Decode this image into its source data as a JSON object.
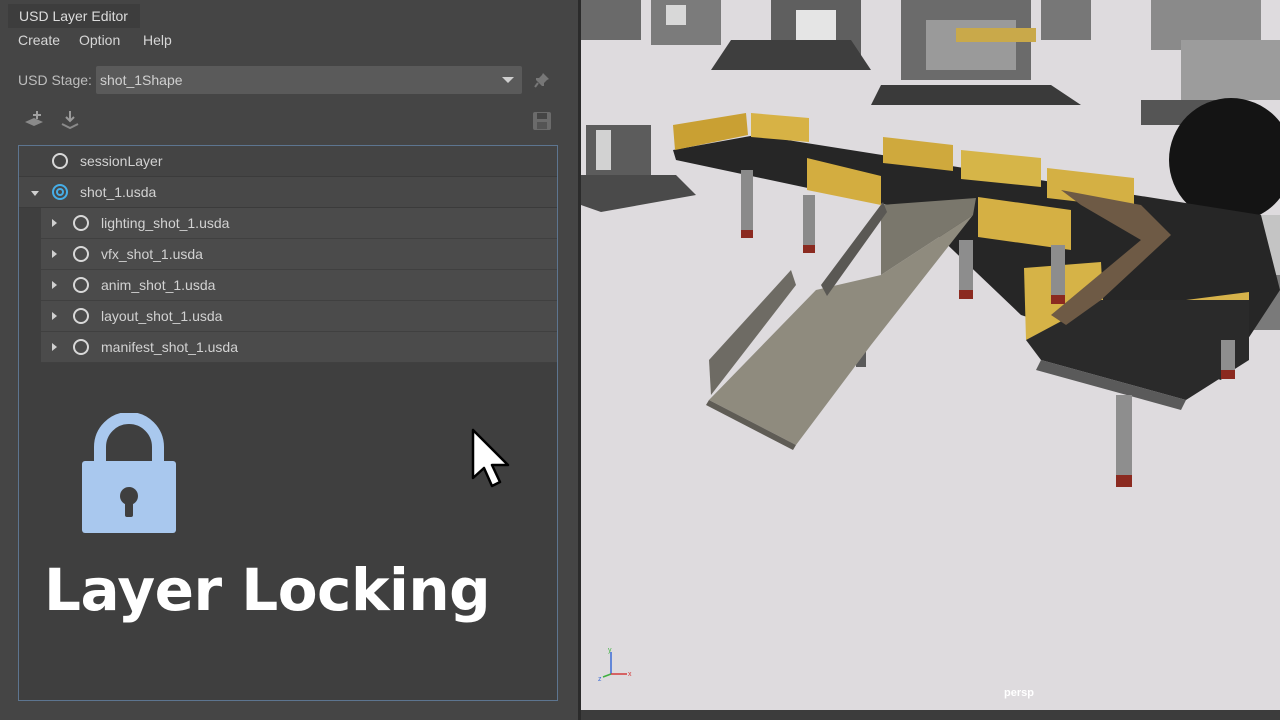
{
  "window": {
    "title": "USD Layer Editor"
  },
  "menu": {
    "items": [
      "Create",
      "Option",
      "Help"
    ]
  },
  "stage": {
    "label": "USD Stage:",
    "value": "shot_1Shape"
  },
  "icons": {
    "add_layer": "add-layer-icon",
    "load_layer": "load-layer-icon",
    "save": "save-icon",
    "pin": "pin-icon",
    "lock": "lock-icon",
    "cursor": "mouse-cursor-icon"
  },
  "layers": {
    "session": "sessionLayer",
    "root": "shot_1.usda",
    "children": [
      "lighting_shot_1.usda",
      "vfx_shot_1.usda",
      "anim_shot_1.usda",
      "layout_shot_1.usda",
      "manifest_shot_1.usda"
    ]
  },
  "overlay": {
    "title": "Layer Locking"
  },
  "viewport": {
    "camera": "persp"
  },
  "colors": {
    "panel_bg": "#454545",
    "tree_border": "#5d7590",
    "target_layer": "#46aee8",
    "lock": "#a9c8ee",
    "viewport_bg": "#dedbde"
  }
}
